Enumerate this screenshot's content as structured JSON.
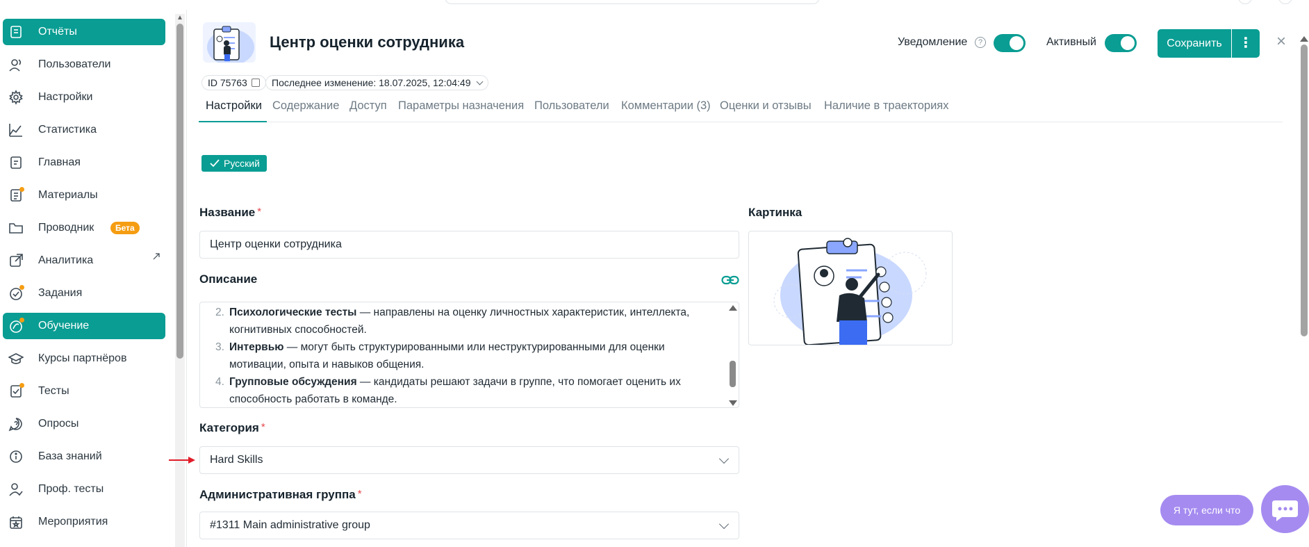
{
  "sidebar": {
    "items": [
      {
        "label": "Отчёты",
        "icon": "reports-icon",
        "active": true,
        "dot": false
      },
      {
        "label": "Пользователи",
        "icon": "users-icon",
        "active": false,
        "dot": false
      },
      {
        "label": "Настройки",
        "icon": "gear-icon",
        "active": false,
        "dot": false
      },
      {
        "label": "Статистика",
        "icon": "chart-icon",
        "active": false,
        "dot": false
      },
      {
        "label": "Главная",
        "icon": "home-icon",
        "active": false,
        "dot": false
      },
      {
        "label": "Материалы",
        "icon": "materials-icon",
        "active": false,
        "dot": true
      },
      {
        "label": "Проводник",
        "icon": "folder-icon",
        "active": false,
        "dot": false,
        "badge": "Бета"
      },
      {
        "label": "Аналитика",
        "icon": "analytics-icon",
        "active": false,
        "dot": false,
        "external": true
      },
      {
        "label": "Задания",
        "icon": "tasks-icon",
        "active": false,
        "dot": true
      },
      {
        "label": "Обучение",
        "icon": "learning-icon",
        "active": true,
        "dot": true
      },
      {
        "label": "Курсы партнёров",
        "icon": "graduation-cap-icon",
        "active": false,
        "dot": false
      },
      {
        "label": "Тесты",
        "icon": "tests-icon",
        "active": false,
        "dot": true
      },
      {
        "label": "Опросы",
        "icon": "survey-icon",
        "active": false,
        "dot": false
      },
      {
        "label": "База знаний",
        "icon": "info-icon",
        "active": false,
        "dot": false
      },
      {
        "label": "Проф. тесты",
        "icon": "prof-tests-icon",
        "active": false,
        "dot": false
      },
      {
        "label": "Мероприятия",
        "icon": "calendar-icon",
        "active": false,
        "dot": false
      }
    ]
  },
  "header": {
    "title": "Центр оценки сотрудника",
    "notification_label": "Уведомление",
    "help_glyph": "?",
    "active_label": "Активный",
    "save_label": "Сохранить",
    "more_glyph": "⋮",
    "close_glyph": "×",
    "id_text": "ID 75763",
    "last_change": "Последнее изменение: 18.07.2025, 12:04:49"
  },
  "tabs": [
    "Настройки",
    "Содержание",
    "Доступ",
    "Параметры назначения",
    "Пользователи",
    "Комментарии (3)",
    "Оценки и отзывы",
    "Наличие в траекториях"
  ],
  "language_chip": "Русский",
  "form": {
    "name_label": "Название",
    "name_value": "Центр оценки сотрудника",
    "required_mark": "*",
    "picture_label": "Картинка",
    "description_label": "Описание",
    "description_items": [
      {
        "num": "2.",
        "bold": "Психологические тесты",
        "text": " — направлены на оценку личностных характеристик, интеллекта, когнитивных способностей."
      },
      {
        "num": "3.",
        "bold": "Интервью",
        "text": " — могут быть структурированными или неструктурированными для оценки мотивации, опыта и навыков общения."
      },
      {
        "num": "4.",
        "bold": "Групповые обсуждения",
        "text": " — кандидаты решают задачи в группе, что помогает оценить их способность работать в команде."
      }
    ],
    "category_label": "Категория",
    "category_value": "Hard Skills",
    "admin_group_label": "Административная группа",
    "admin_group_value": "#1311 Main administrative group"
  },
  "chat": {
    "hint": "Я тут, если что"
  },
  "colors": {
    "accent": "#0a9d93",
    "badge": "#f59d12",
    "chat": "#a58bf0",
    "required": "#e5484d"
  }
}
